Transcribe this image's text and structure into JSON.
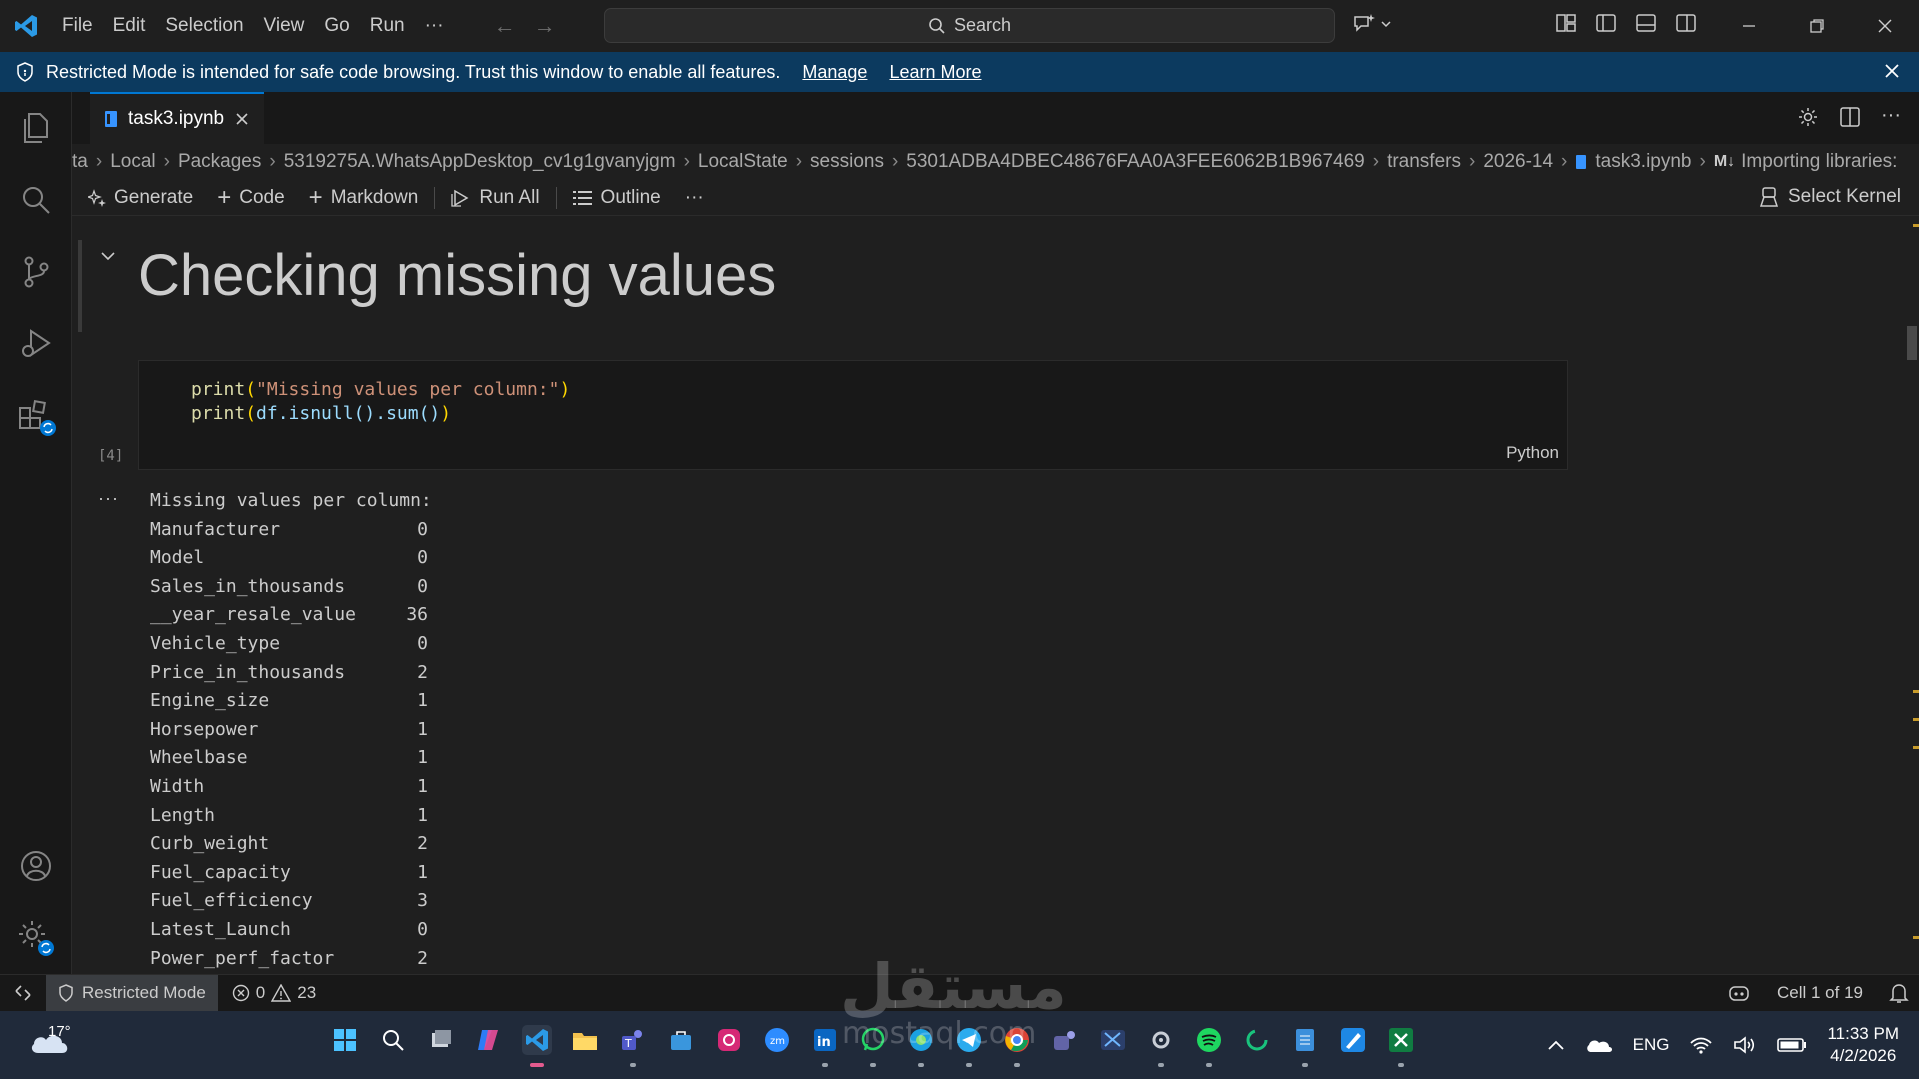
{
  "titlebar": {
    "menu": [
      "File",
      "Edit",
      "Selection",
      "View",
      "Go",
      "Run",
      "···"
    ],
    "search_label": "Search"
  },
  "banner": {
    "message": "Restricted Mode is intended for safe code browsing. Trust this window to enable all features.",
    "manage_label": "Manage",
    "learn_more_label": "Learn More"
  },
  "tab": {
    "label": "task3.ipynb"
  },
  "breadcrumb": [
    "ta",
    "Local",
    "Packages",
    "5319275A.WhatsAppDesktop_cv1g1gvanyjgm",
    "LocalState",
    "sessions",
    "5301ADBA4DBEC48676FAA0A3FEE6062B1B967469",
    "transfers",
    "2026-14",
    "task3.ipynb",
    "Importing libraries:"
  ],
  "toolbar": {
    "generate": "Generate",
    "code": "Code",
    "markdown": "Markdown",
    "run_all": "Run All",
    "outline": "Outline",
    "more": "···",
    "kernel": "Select Kernel"
  },
  "notebook": {
    "heading": "Checking missing values",
    "code": {
      "line1_fn": "print",
      "line1_str": "\"Missing values per column:\"",
      "line2_fn": "print",
      "line2_rest": "df.isnull().sum()",
      "exec_count": "[4]",
      "language": "Python"
    },
    "output_header": "Missing values per column:",
    "output_rows": [
      {
        "name": "Manufacturer",
        "value": "0"
      },
      {
        "name": "Model",
        "value": "0"
      },
      {
        "name": "Sales_in_thousands",
        "value": "0"
      },
      {
        "name": "__year_resale_value",
        "value": "36"
      },
      {
        "name": "Vehicle_type",
        "value": "0"
      },
      {
        "name": "Price_in_thousands",
        "value": "2"
      },
      {
        "name": "Engine_size",
        "value": "1"
      },
      {
        "name": "Horsepower",
        "value": "1"
      },
      {
        "name": "Wheelbase",
        "value": "1"
      },
      {
        "name": "Width",
        "value": "1"
      },
      {
        "name": "Length",
        "value": "1"
      },
      {
        "name": "Curb_weight",
        "value": "2"
      },
      {
        "name": "Fuel_capacity",
        "value": "1"
      },
      {
        "name": "Fuel_efficiency",
        "value": "3"
      },
      {
        "name": "Latest_Launch",
        "value": "0"
      },
      {
        "name": "Power_perf_factor",
        "value": "2"
      }
    ]
  },
  "statusbar": {
    "restricted": "Restricted Mode",
    "errors": "0",
    "warnings": "23",
    "cell": "Cell 1 of 19"
  },
  "taskbar": {
    "temperature": "17°",
    "language": "ENG",
    "time": "11:33 PM",
    "date": "4/2/2026"
  },
  "watermark": {
    "main": "مستقل",
    "sub": "mostaql.com"
  },
  "colors": {
    "accent": "#0078d4",
    "banner": "#0c3a5f",
    "string": "#ce9178",
    "function": "#dcdcaa",
    "paren": "#da70d6"
  }
}
